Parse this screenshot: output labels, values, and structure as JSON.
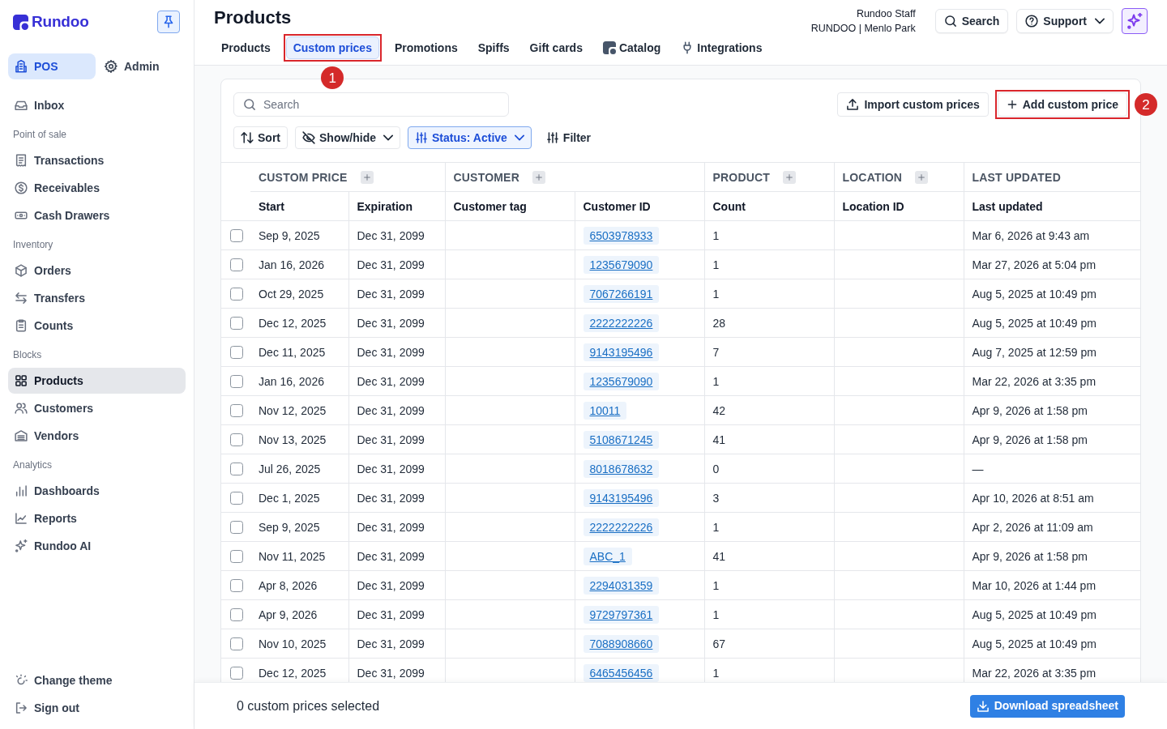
{
  "sidebar": {
    "brand": "Rundoo",
    "modes": [
      {
        "label": "POS",
        "selected": true
      },
      {
        "label": "Admin",
        "selected": false
      }
    ],
    "top_items": [
      {
        "label": "Inbox",
        "selected": false
      }
    ],
    "sections": [
      {
        "title": "Point of sale",
        "items": [
          {
            "label": "Transactions",
            "selected": false
          },
          {
            "label": "Receivables",
            "selected": false
          },
          {
            "label": "Cash Drawers",
            "selected": false
          }
        ]
      },
      {
        "title": "Inventory",
        "items": [
          {
            "label": "Orders",
            "selected": false
          },
          {
            "label": "Transfers",
            "selected": false
          },
          {
            "label": "Counts",
            "selected": false
          }
        ]
      },
      {
        "title": "Blocks",
        "items": [
          {
            "label": "Products",
            "selected": true
          },
          {
            "label": "Customers",
            "selected": false
          },
          {
            "label": "Vendors",
            "selected": false
          }
        ]
      },
      {
        "title": "Analytics",
        "items": [
          {
            "label": "Dashboards",
            "selected": false
          },
          {
            "label": "Reports",
            "selected": false
          },
          {
            "label": "Rundoo AI",
            "selected": false
          }
        ]
      }
    ],
    "bottom_items": [
      {
        "label": "Change theme"
      },
      {
        "label": "Sign out"
      }
    ]
  },
  "header": {
    "title": "Products",
    "tabs": [
      {
        "label": "Products",
        "selected": false
      },
      {
        "label": "Custom prices",
        "selected": true,
        "callout": "1"
      },
      {
        "label": "Promotions",
        "selected": false
      },
      {
        "label": "Spiffs",
        "selected": false
      },
      {
        "label": "Gift cards",
        "selected": false
      },
      {
        "label": "Catalog",
        "selected": false
      },
      {
        "label": "Integrations",
        "selected": false
      }
    ],
    "user": {
      "name": "Rundoo Staff",
      "store": "RUNDOO | Menlo Park"
    },
    "search_button": "Search",
    "support_button": "Support"
  },
  "toolbar": {
    "search": {
      "placeholder": "Search"
    },
    "import_button": "Import custom prices",
    "add_button": {
      "label": "Add custom price",
      "callout": "2"
    },
    "sort_button": "Sort",
    "show_hide_button": "Show/hide",
    "status_filter": {
      "label": "Status: Active",
      "active": true
    },
    "filter_button": "Filter"
  },
  "table": {
    "groups": [
      {
        "label": "CUSTOM PRICE",
        "addable": true,
        "columns": [
          "Start",
          "Expiration"
        ]
      },
      {
        "label": "CUSTOMER",
        "addable": true,
        "columns": [
          "Customer tag",
          "Customer ID"
        ]
      },
      {
        "label": "PRODUCT",
        "addable": true,
        "columns": [
          "Count"
        ]
      },
      {
        "label": "LOCATION",
        "addable": true,
        "columns": [
          "Location ID"
        ]
      },
      {
        "label": "LAST UPDATED",
        "addable": false,
        "columns": [
          "Last updated"
        ]
      }
    ],
    "rows": [
      {
        "selected": false,
        "start": "Sep 9, 2025",
        "expiration": "Dec 31, 2099",
        "customer_id": "6503978933",
        "count": "1",
        "last_updated": "Mar 6, 2026 at 9:43 am"
      },
      {
        "selected": false,
        "start": "Jan 16, 2026",
        "expiration": "Dec 31, 2099",
        "customer_id": "1235679090",
        "count": "1",
        "last_updated": "Mar 27, 2026 at 5:04 pm"
      },
      {
        "selected": false,
        "start": "Oct 29, 2025",
        "expiration": "Dec 31, 2099",
        "customer_id": "7067266191",
        "count": "1",
        "last_updated": "Aug 5, 2025 at 10:49 pm"
      },
      {
        "selected": false,
        "start": "Dec 12, 2025",
        "expiration": "Dec 31, 2099",
        "customer_id": "2222222226",
        "count": "28",
        "last_updated": "Aug 5, 2025 at 10:49 pm"
      },
      {
        "selected": false,
        "start": "Dec 11, 2025",
        "expiration": "Dec 31, 2099",
        "customer_id": "9143195496",
        "count": "7",
        "last_updated": "Aug 7, 2025 at 12:59 pm"
      },
      {
        "selected": false,
        "start": "Jan 16, 2026",
        "expiration": "Dec 31, 2099",
        "customer_id": "1235679090",
        "count": "1",
        "last_updated": "Mar 22, 2026 at 3:35 pm"
      },
      {
        "selected": false,
        "start": "Nov 12, 2025",
        "expiration": "Dec 31, 2099",
        "customer_id": "10011",
        "count": "42",
        "last_updated": "Apr 9, 2026 at 1:58 pm"
      },
      {
        "selected": false,
        "start": "Nov 13, 2025",
        "expiration": "Dec 31, 2099",
        "customer_id": "5108671245",
        "count": "41",
        "last_updated": "Apr 9, 2026 at 1:58 pm"
      },
      {
        "selected": false,
        "start": "Jul 26, 2025",
        "expiration": "Dec 31, 2099",
        "customer_id": "8018678632",
        "count": "0",
        "last_updated": "—"
      },
      {
        "selected": false,
        "start": "Dec 1, 2025",
        "expiration": "Dec 31, 2099",
        "customer_id": "9143195496",
        "count": "3",
        "last_updated": "Apr 10, 2026 at 8:51 am"
      },
      {
        "selected": false,
        "start": "Sep 9, 2025",
        "expiration": "Dec 31, 2099",
        "customer_id": "2222222226",
        "count": "1",
        "last_updated": "Apr 2, 2026 at 11:09 am"
      },
      {
        "selected": false,
        "start": "Nov 11, 2025",
        "expiration": "Dec 31, 2099",
        "customer_id": "ABC_1",
        "count": "41",
        "last_updated": "Apr 9, 2026 at 1:58 pm"
      },
      {
        "selected": false,
        "start": "Apr 8, 2026",
        "expiration": "Dec 31, 2099",
        "customer_id": "2294031359",
        "count": "1",
        "last_updated": "Mar 10, 2026 at 1:44 pm"
      },
      {
        "selected": false,
        "start": "Apr 9, 2026",
        "expiration": "Dec 31, 2099",
        "customer_id": "9729797361",
        "count": "1",
        "last_updated": "Aug 5, 2025 at 10:49 pm"
      },
      {
        "selected": false,
        "start": "Nov 10, 2025",
        "expiration": "Dec 31, 2099",
        "customer_id": "7088908660",
        "count": "67",
        "last_updated": "Aug 5, 2025 at 10:49 pm"
      },
      {
        "selected": false,
        "start": "Dec 12, 2025",
        "expiration": "Dec 31, 2099",
        "customer_id": "6465456456",
        "count": "1",
        "last_updated": "Mar 22, 2026 at 3:35 pm"
      }
    ]
  },
  "footer": {
    "selection_summary": "0 custom prices selected",
    "download_button": "Download spreadsheet"
  }
}
